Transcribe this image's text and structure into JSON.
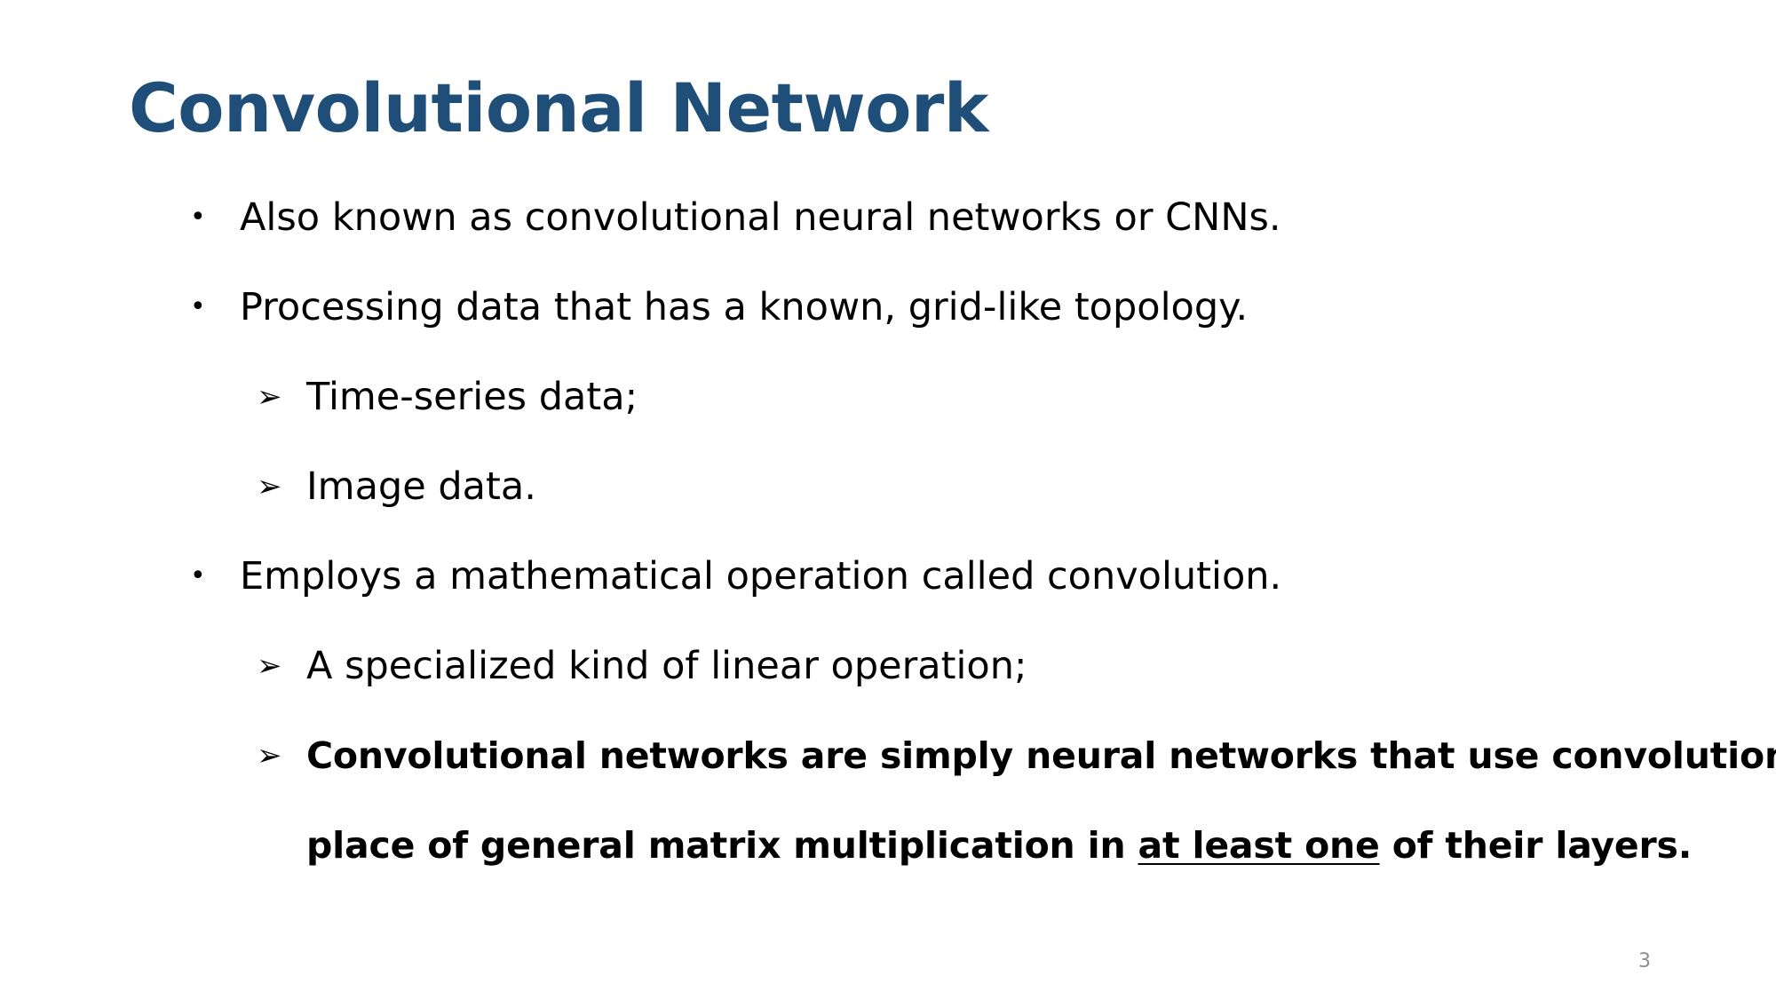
{
  "slide": {
    "title": "Convolutional Network",
    "bullet_symbol": "•",
    "sub_bullet_symbol": "➢",
    "items": [
      {
        "text": "Also known as convolutional neural networks or CNNs."
      },
      {
        "text": "Processing data that has a known, grid-like topology."
      },
      {
        "text": "Time-series data;"
      },
      {
        "text": "Image data."
      },
      {
        "text": "Employs a mathematical operation called convolution."
      },
      {
        "text": "A specialized kind of linear operation;"
      },
      {
        "line1": "Convolutional networks are simply neural networks that use convolution in",
        "line2_before": "place of general matrix multiplication in ",
        "line2_underlined": "at least one",
        "line2_after": " of their layers."
      }
    ],
    "page_number": "3"
  },
  "colors": {
    "title": "#1f4e79",
    "text": "#000000",
    "page_number": "#8c8c8c"
  }
}
